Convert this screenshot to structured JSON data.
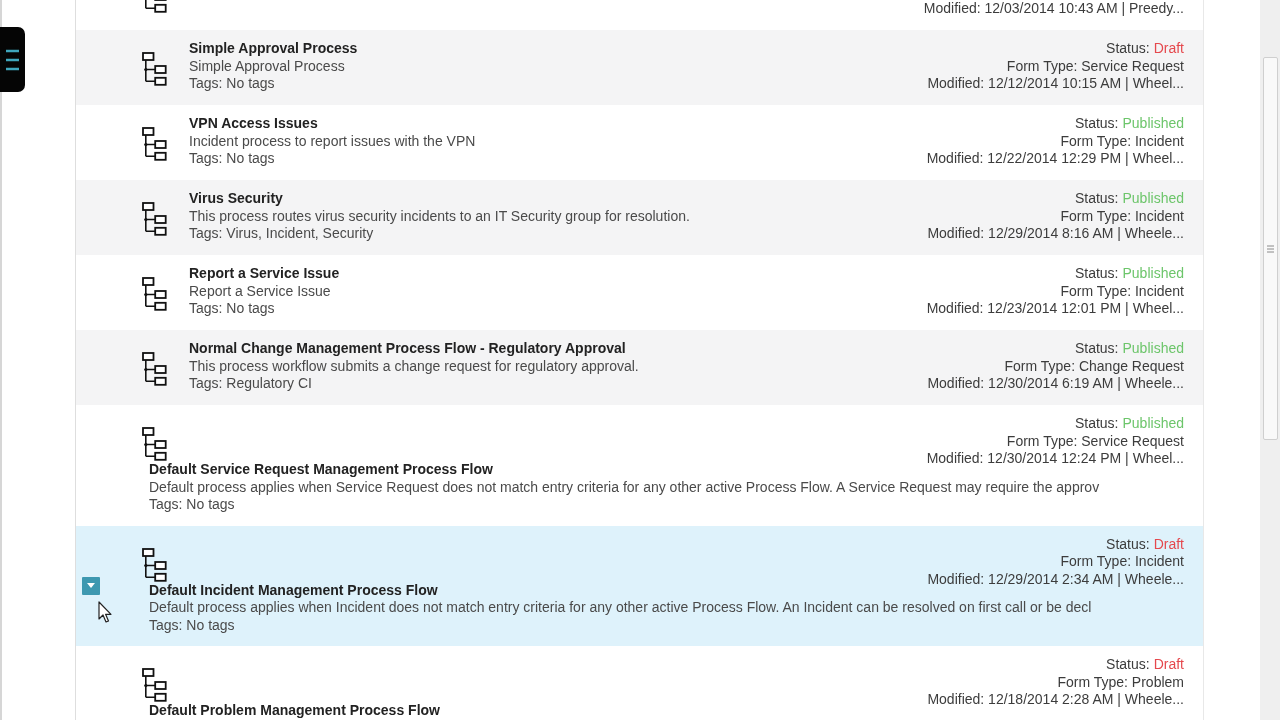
{
  "processes": [
    {
      "kind": "cut",
      "selected": false,
      "modified": "Modified: 12/03/2014 10:43 AM | Preedy..."
    },
    {
      "kind": "compact",
      "selected": false,
      "title": "Simple Approval Process",
      "description": "Simple Approval Process",
      "tags": "Tags: No tags",
      "status": {
        "label": "Status:",
        "value": "Draft",
        "color": "#e5484d"
      },
      "form_type": "Form Type: Service Request",
      "modified": "Modified: 12/12/2014 10:15 AM | Wheel..."
    },
    {
      "kind": "compact",
      "selected": false,
      "title": "VPN Access Issues",
      "description": "Incident process to report issues with the VPN",
      "tags": "Tags: No tags",
      "status": {
        "label": "Status:",
        "value": "Published",
        "color": "#6cc56a"
      },
      "form_type": "Form Type: Incident",
      "modified": "Modified: 12/22/2014 12:29 PM | Wheel..."
    },
    {
      "kind": "compact",
      "selected": false,
      "title": "Virus Security",
      "description": "This process routes virus security incidents to an IT Security group for resolution.",
      "tags": "Tags: Virus, Incident, Security",
      "status": {
        "label": "Status:",
        "value": "Published",
        "color": "#6cc56a"
      },
      "form_type": "Form Type: Incident",
      "modified": "Modified: 12/29/2014 8:16 AM | Wheele..."
    },
    {
      "kind": "compact",
      "selected": false,
      "title": "Report a Service Issue",
      "description": "Report a Service Issue",
      "tags": "Tags: No tags",
      "status": {
        "label": "Status:",
        "value": "Published",
        "color": "#6cc56a"
      },
      "form_type": "Form Type: Incident",
      "modified": "Modified: 12/23/2014 12:01 PM | Wheel..."
    },
    {
      "kind": "compact",
      "selected": false,
      "title": "Normal Change Management Process Flow - Regulatory Approval",
      "description": "This process workflow submits a change request for regulatory approval.",
      "tags": "Tags: Regulatory CI",
      "status": {
        "label": "Status:",
        "value": "Published",
        "color": "#6cc56a"
      },
      "form_type": "Form Type: Change Request",
      "modified": "Modified: 12/30/2014 6:19 AM | Wheele..."
    },
    {
      "kind": "wide",
      "selected": false,
      "title": "Default Service Request Management Process Flow",
      "description": "Default process applies when Service Request does not match entry criteria for any other active Process Flow. A Service Request may require the approv",
      "tags": "Tags: No tags",
      "status": {
        "label": "Status:",
        "value": "Published",
        "color": "#6cc56a"
      },
      "form_type": "Form Type: Service Request",
      "modified": "Modified: 12/30/2014 12:24 PM | Wheel..."
    },
    {
      "kind": "wide",
      "selected": true,
      "title": "Default Incident Management Process Flow",
      "description": "Default process applies when Incident does not match entry criteria for any other active Process Flow. An Incident can be resolved on first call or be decl",
      "tags": "Tags: No tags",
      "status": {
        "label": "Status:",
        "value": "Draft",
        "color": "#e5484d"
      },
      "form_type": "Form Type: Incident",
      "modified": "Modified: 12/29/2014 2:34 AM | Wheele..."
    },
    {
      "kind": "wide",
      "selected": false,
      "title": "Default Problem Management Process Flow",
      "status": {
        "label": "Status:",
        "value": "Draft",
        "color": "#e5484d"
      },
      "form_type": "Form Type: Problem",
      "modified": "Modified: 12/18/2014 2:28 AM | Wheele..."
    }
  ]
}
